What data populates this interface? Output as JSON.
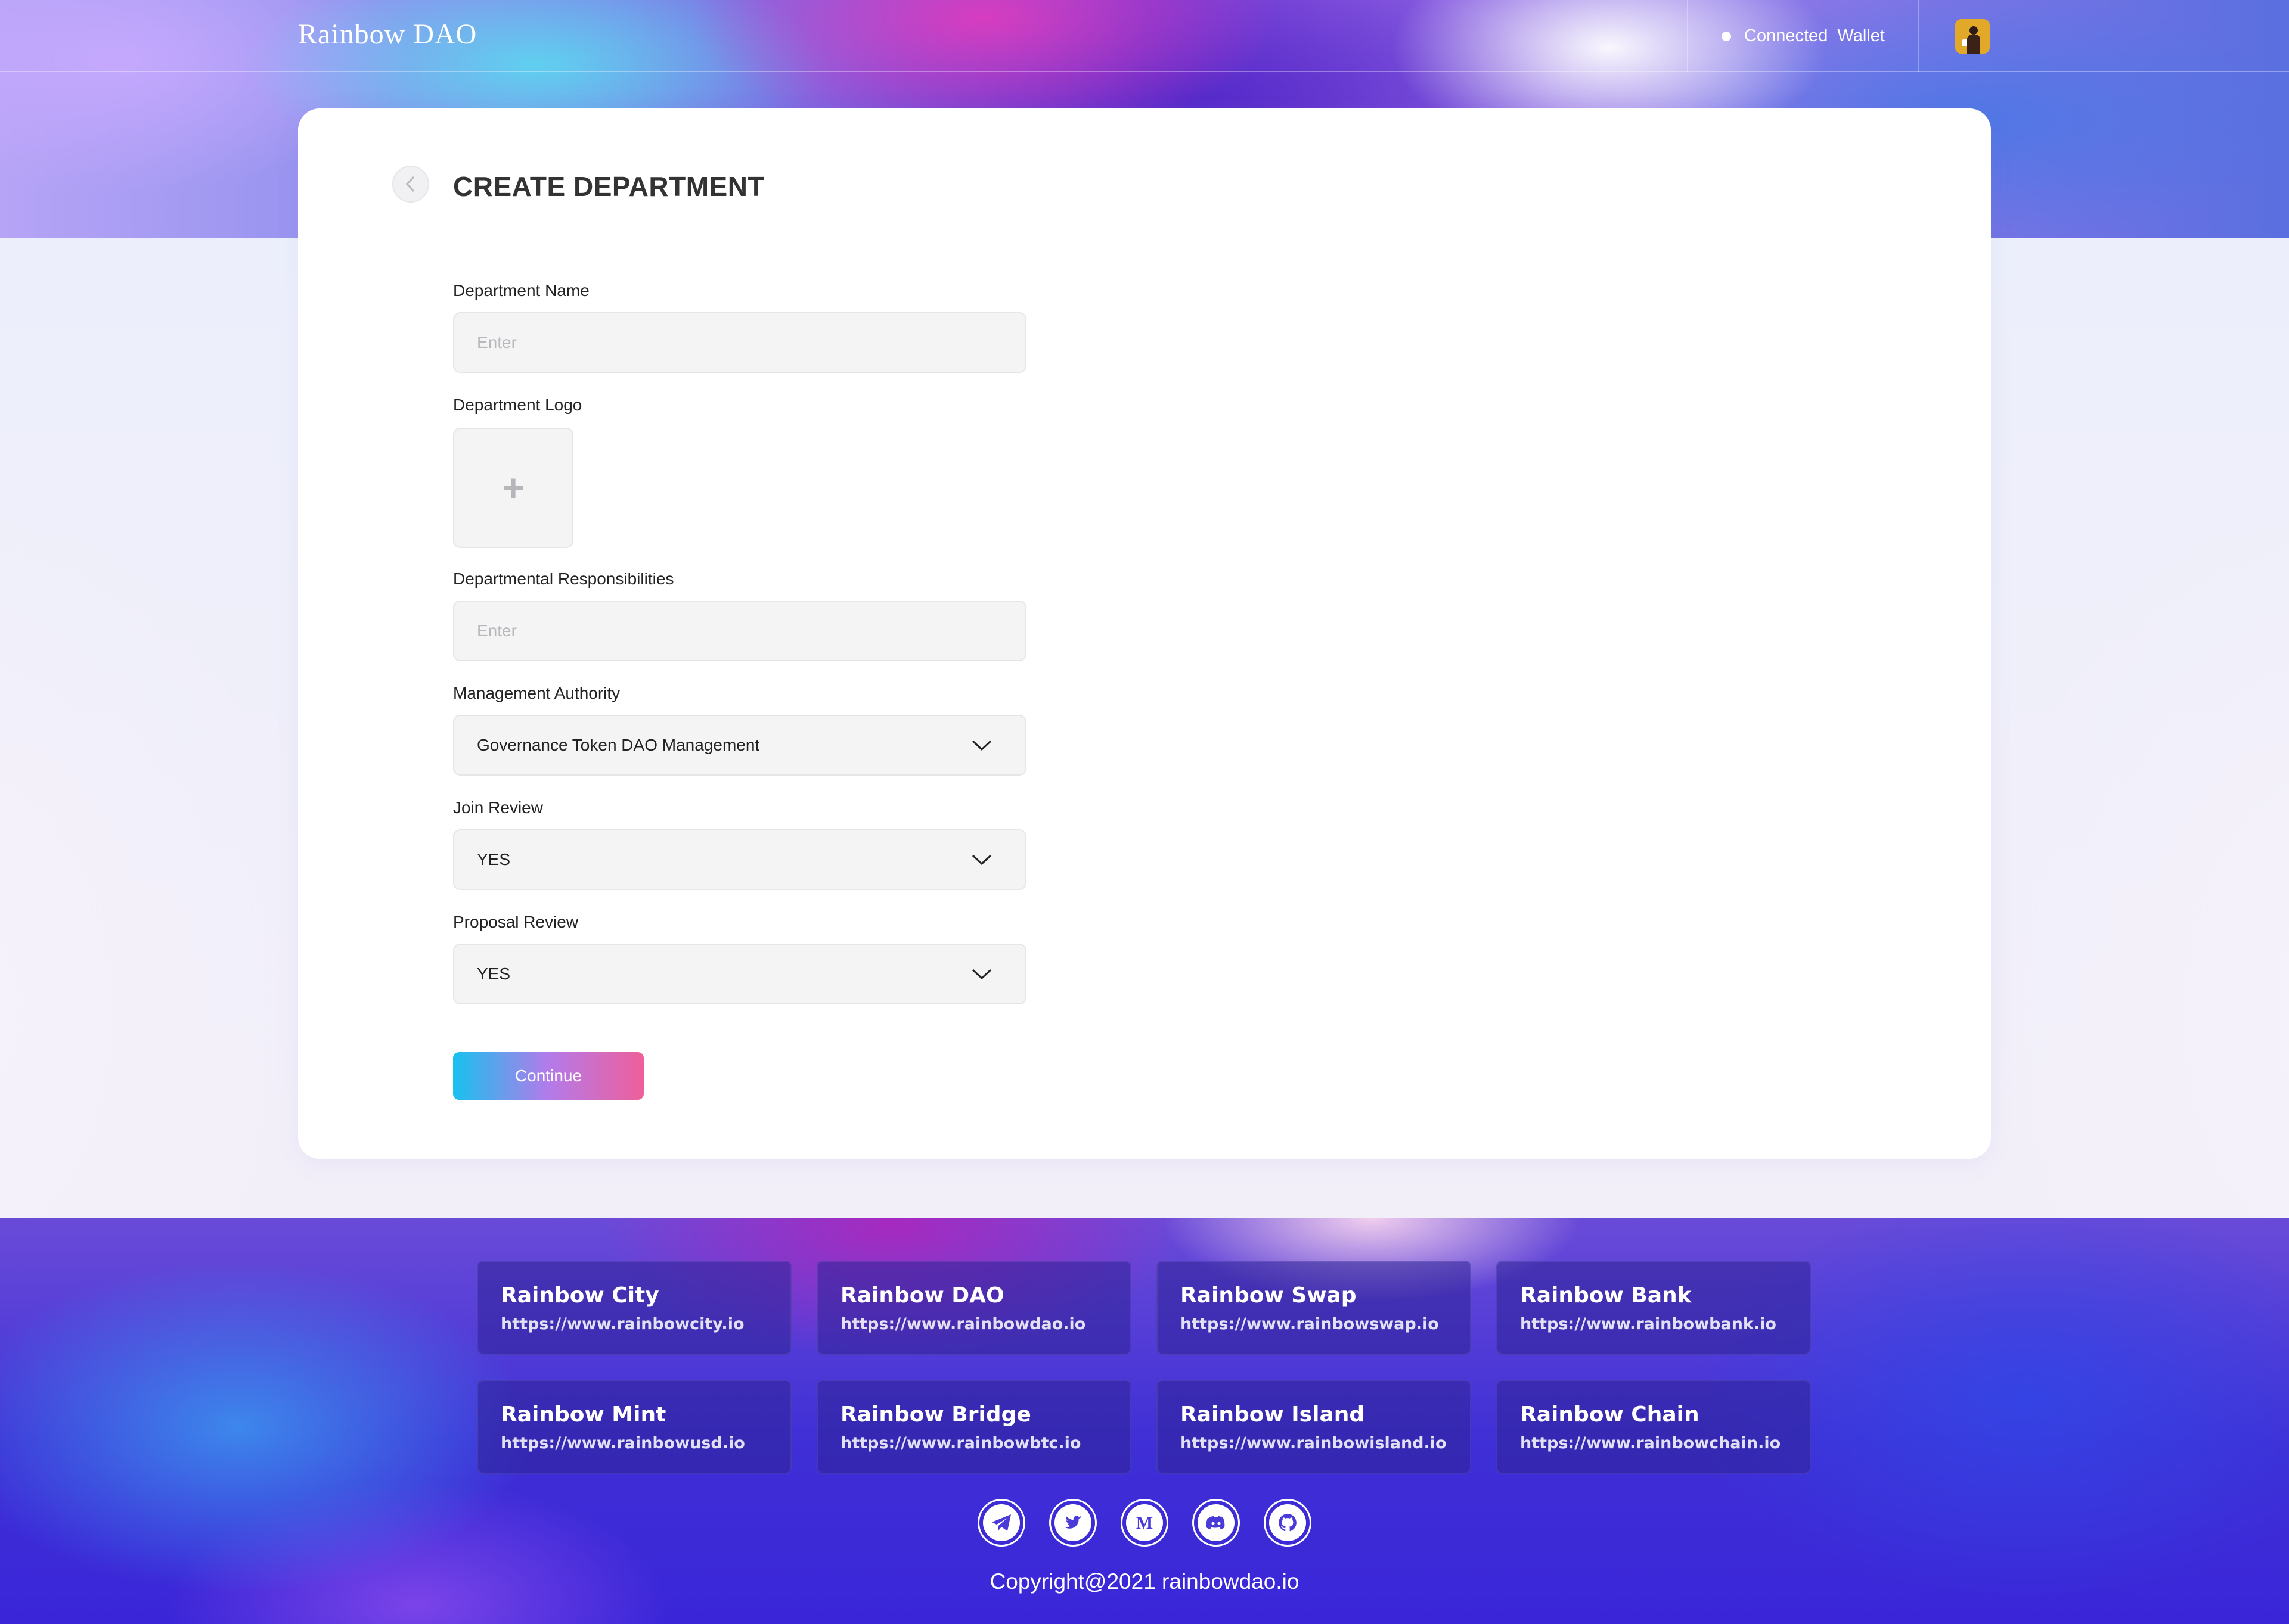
{
  "header": {
    "logo": "Rainbow DAO",
    "wallet_label": "Connected  Wallet"
  },
  "form": {
    "title": "CREATE DEPARTMENT",
    "name_label": "Department Name",
    "name_placeholder": "Enter",
    "logo_label": "Department Logo",
    "logo_upload_glyph": "+",
    "responsibilities_label": "Departmental Responsibilities",
    "responsibilities_placeholder": "Enter",
    "authority_label": "Management Authority",
    "authority_value": "Governance Token DAO Management",
    "join_review_label": "Join Review",
    "join_review_value": "YES",
    "proposal_review_label": "Proposal Review",
    "proposal_review_value": "YES",
    "continue_label": "Continue"
  },
  "footer": {
    "sites": [
      {
        "name": "Rainbow City",
        "url": "https://www.rainbowcity.io"
      },
      {
        "name": "Rainbow DAO",
        "url": "https://www.rainbowdao.io"
      },
      {
        "name": "Rainbow Swap",
        "url": "https://www.rainbowswap.io"
      },
      {
        "name": "Rainbow Bank",
        "url": "https://www.rainbowbank.io"
      },
      {
        "name": "Rainbow Mint",
        "url": "https://www.rainbowusd.io"
      },
      {
        "name": "Rainbow Bridge",
        "url": "https://www.rainbowbtc.io"
      },
      {
        "name": "Rainbow Island",
        "url": "https://www.rainbowisland.io"
      },
      {
        "name": "Rainbow Chain",
        "url": "https://www.rainbowchain.io"
      }
    ],
    "social_icons": [
      "telegram-icon",
      "twitter-icon",
      "medium-icon",
      "discord-icon",
      "github-icon"
    ],
    "copyright": "Copyright@2021 rainbowdao.io"
  },
  "colors": {
    "button_gradient": [
      "#18c1ee",
      "#b37bea",
      "#ee5f9b"
    ],
    "footer_primary": "#3f2fd6"
  }
}
